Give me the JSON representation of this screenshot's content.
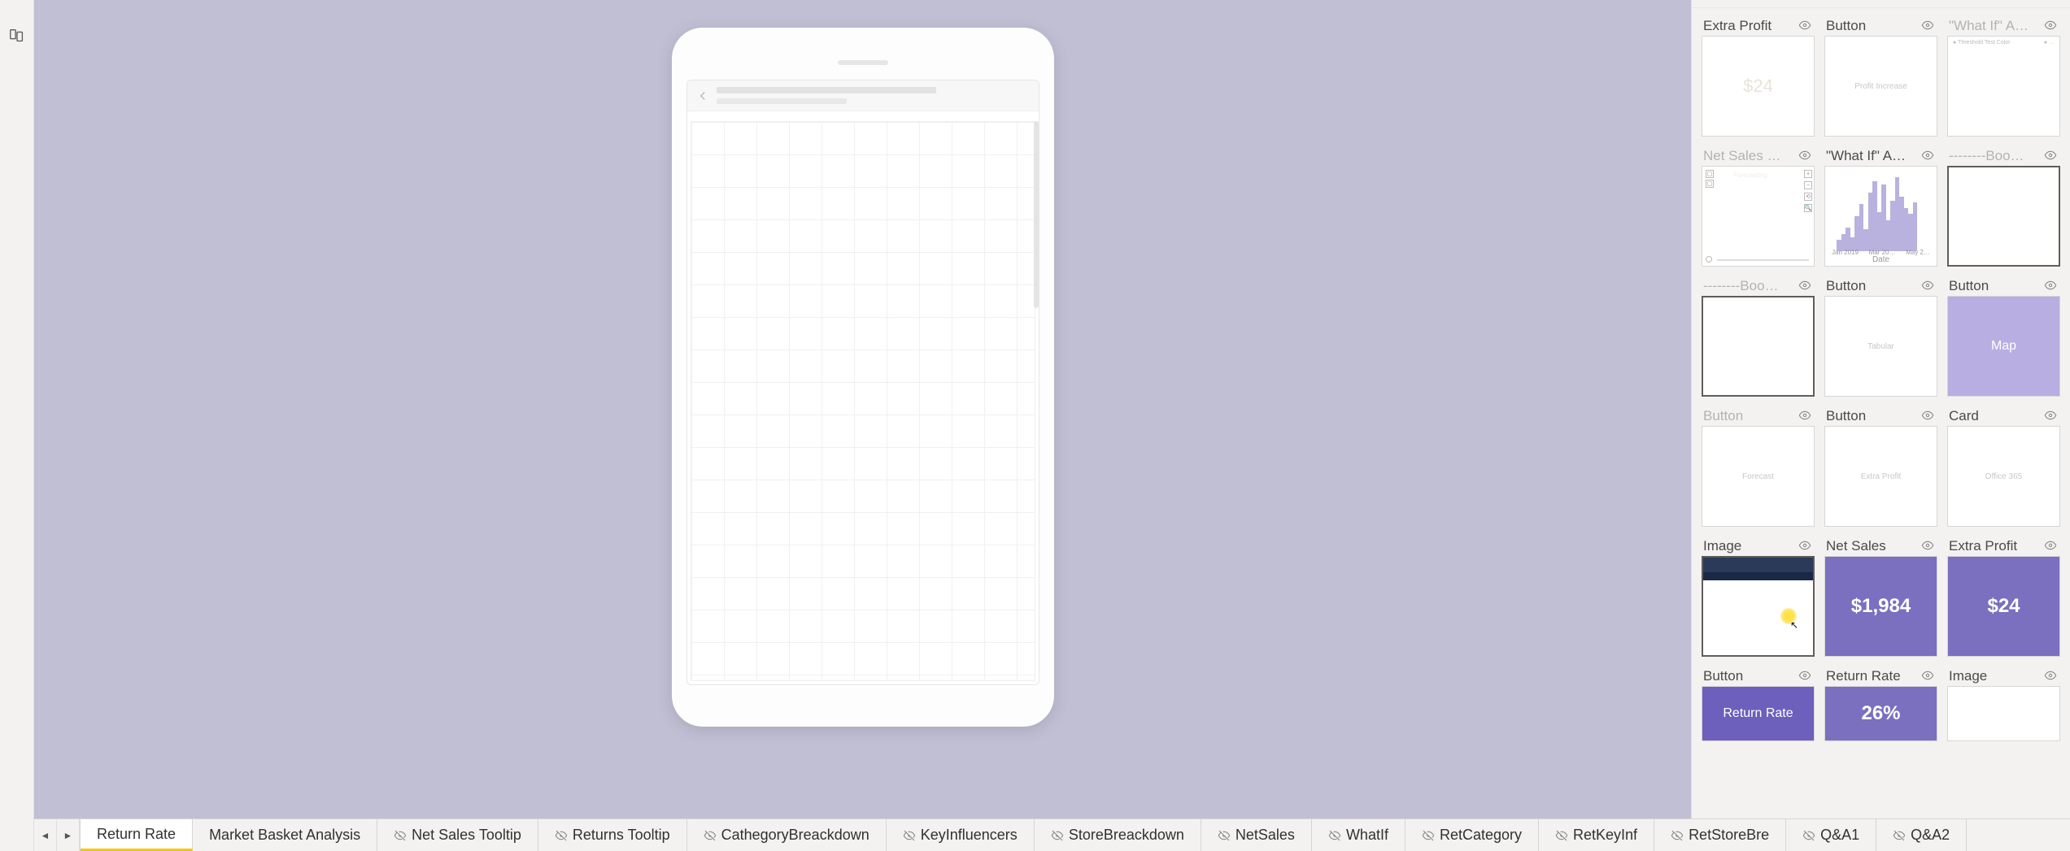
{
  "tabs": [
    {
      "label": "Return Rate",
      "hidden": false,
      "active": true
    },
    {
      "label": "Market Basket Analysis",
      "hidden": false,
      "active": false
    },
    {
      "label": "Net Sales Tooltip",
      "hidden": true,
      "active": false
    },
    {
      "label": "Returns Tooltip",
      "hidden": true,
      "active": false
    },
    {
      "label": "CathegoryBreackdown",
      "hidden": true,
      "active": false
    },
    {
      "label": "KeyInfluencers",
      "hidden": true,
      "active": false
    },
    {
      "label": "StoreBreackdown",
      "hidden": true,
      "active": false
    },
    {
      "label": "NetSales",
      "hidden": true,
      "active": false
    },
    {
      "label": "WhatIf",
      "hidden": true,
      "active": false
    },
    {
      "label": "RetCategory",
      "hidden": true,
      "active": false
    },
    {
      "label": "RetKeyInf",
      "hidden": true,
      "active": false
    },
    {
      "label": "RetStoreBre",
      "hidden": true,
      "active": false
    },
    {
      "label": "Q&A1",
      "hidden": true,
      "active": false
    },
    {
      "label": "Q&A2",
      "hidden": true,
      "active": false
    }
  ],
  "visuals": {
    "row1": [
      {
        "title": "Extra Profit",
        "dim": false,
        "inner": "$24",
        "style": "pale-value"
      },
      {
        "title": "Button",
        "dim": false,
        "inner": "Profit Increase",
        "style": "tiny-label"
      },
      {
        "title": "\"What If\" Analysi…",
        "dim": true,
        "inner": "",
        "style": "legend-only",
        "legend": [
          "Threshold Test Color",
          "…"
        ]
      }
    ],
    "row2": [
      {
        "title": "Net Sales (Forec…",
        "dim": true,
        "inner": "",
        "style": "minimap",
        "word": "Forecasting"
      },
      {
        "title": "\"What If\" Analysi…",
        "dim": false,
        "inner": "",
        "style": "barchart",
        "axis": "Date",
        "dates": [
          "Jan 2019",
          "Mar 20…",
          "May 2…"
        ]
      },
      {
        "title": "--------Bookmark…",
        "dim": true,
        "inner": "",
        "style": "empty",
        "selected": true
      }
    ],
    "row3": [
      {
        "title": "--------Bookmark…",
        "dim": true,
        "inner": "",
        "style": "empty",
        "selected": true
      },
      {
        "title": "Button",
        "dim": false,
        "inner": "Tabular",
        "style": "tiny-label"
      },
      {
        "title": "Button",
        "dim": false,
        "inner": "Map",
        "style": "purple-light"
      }
    ],
    "row4": [
      {
        "title": "Button",
        "dim": true,
        "inner": "Forecast",
        "style": "tiny-label"
      },
      {
        "title": "Button",
        "dim": false,
        "inner": "Extra Profit",
        "style": "tiny-label"
      },
      {
        "title": "Card",
        "dim": false,
        "inner": "Office 365",
        "style": "tiny-label"
      }
    ],
    "row5": [
      {
        "title": "Image",
        "dim": false,
        "inner": "",
        "style": "img-cursor",
        "selected": true
      },
      {
        "title": "Net Sales",
        "dim": false,
        "inner": "$1,984",
        "style": "purple"
      },
      {
        "title": "Extra Profit",
        "dim": false,
        "inner": "$24",
        "style": "purple-plain"
      }
    ],
    "row6": [
      {
        "title": "Button",
        "dim": false,
        "inner": "Return Rate",
        "style": "purple-med"
      },
      {
        "title": "Return Rate",
        "dim": false,
        "inner": "26%",
        "style": "purple"
      },
      {
        "title": "Image",
        "dim": false,
        "inner": "",
        "style": "empty"
      }
    ]
  }
}
